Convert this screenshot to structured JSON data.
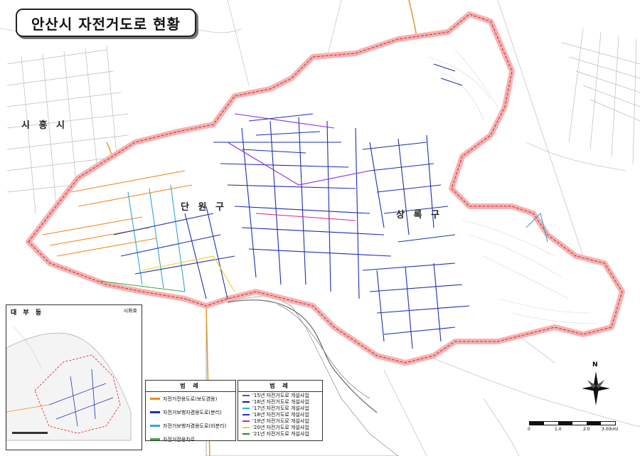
{
  "title": "안산시 자전거도로 현황",
  "districts": {
    "siheung": "시 흥 시",
    "danwon": "단 원 구",
    "sangnok": "상 록 구"
  },
  "inset": {
    "label_daebu": "대 부 동",
    "label_hwaseong": "시화호"
  },
  "legend_types": {
    "header": "범 례",
    "items": [
      {
        "label": "자전거전용도로(보도겸용)",
        "color": "#f08a1c"
      },
      {
        "label": "자전거보행자겸용도로(분리)",
        "color": "#1c2fb0"
      },
      {
        "label": "자전거보행자겸용도로(비분리)",
        "color": "#2aa8e0"
      },
      {
        "label": "자전거전용차로",
        "color": "#3aa83a"
      }
    ]
  },
  "legend_years": {
    "header": "범 례",
    "items": [
      {
        "label": "'15년 자전거도로 개설사업",
        "color": "#8a2be2"
      },
      {
        "label": "'16년 자전거도로 개설사업",
        "color": "#1a1aa0"
      },
      {
        "label": "'17년 자전거도로 개설사업",
        "color": "#2ab0e0"
      },
      {
        "label": "'18년 자전거도로 개설사업",
        "color": "#2a2ad0"
      },
      {
        "label": "'19년 자전거도로 개설사업",
        "color": "#e0208a"
      },
      {
        "label": "'20년 자전거도로 개설사업",
        "color": "#f0d020"
      },
      {
        "label": "'21년 자전거도로 개설사업",
        "color": "#1a8a3a"
      }
    ]
  },
  "scale": {
    "ticks": [
      "0",
      "1.0",
      "2.0",
      "3.0(km)"
    ]
  },
  "compass_label": "N"
}
